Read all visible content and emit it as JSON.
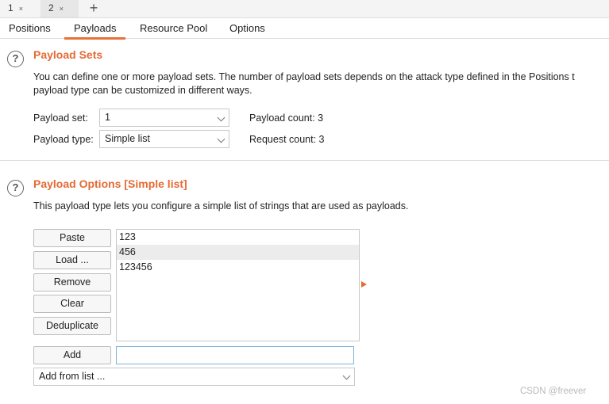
{
  "instance_tabs": [
    {
      "label": "1",
      "close": "×"
    },
    {
      "label": "2",
      "close": "×"
    }
  ],
  "add_tab_symbol": "+",
  "sub_tabs": [
    "Positions",
    "Payloads",
    "Resource Pool",
    "Options"
  ],
  "active_sub_tab": "Payloads",
  "payload_sets": {
    "title": "Payload Sets",
    "help_symbol": "?",
    "description_line1": "You can define one or more payload sets. The number of payload sets depends on the attack type defined in the Positions t",
    "description_line2": "payload type can be customized in different ways.",
    "set_label": "Payload set:",
    "set_value": "1",
    "type_label": "Payload type:",
    "type_value": "Simple list",
    "payload_count": "Payload count: 3",
    "request_count": "Request count: 3"
  },
  "payload_options": {
    "title": "Payload Options [Simple list]",
    "help_symbol": "?",
    "description": "This payload type lets you configure a simple list of strings that are used as payloads.",
    "buttons": {
      "paste": "Paste",
      "load": "Load ...",
      "remove": "Remove",
      "clear": "Clear",
      "deduplicate": "Deduplicate",
      "add": "Add"
    },
    "list_items": [
      "123",
      "456",
      "123456"
    ],
    "selected_index": 1,
    "add_input_value": "",
    "add_from_list": "Add from list ..."
  },
  "watermark": "CSDN @freever",
  "colors": {
    "accent": "#e46a35",
    "tab_active_underline": "#e8703a",
    "input_focus_border": "#7fb3d8"
  },
  "icons": [
    "help-icon",
    "chevron-down-icon",
    "close-icon",
    "plus-icon",
    "arrow-right-icon"
  ]
}
